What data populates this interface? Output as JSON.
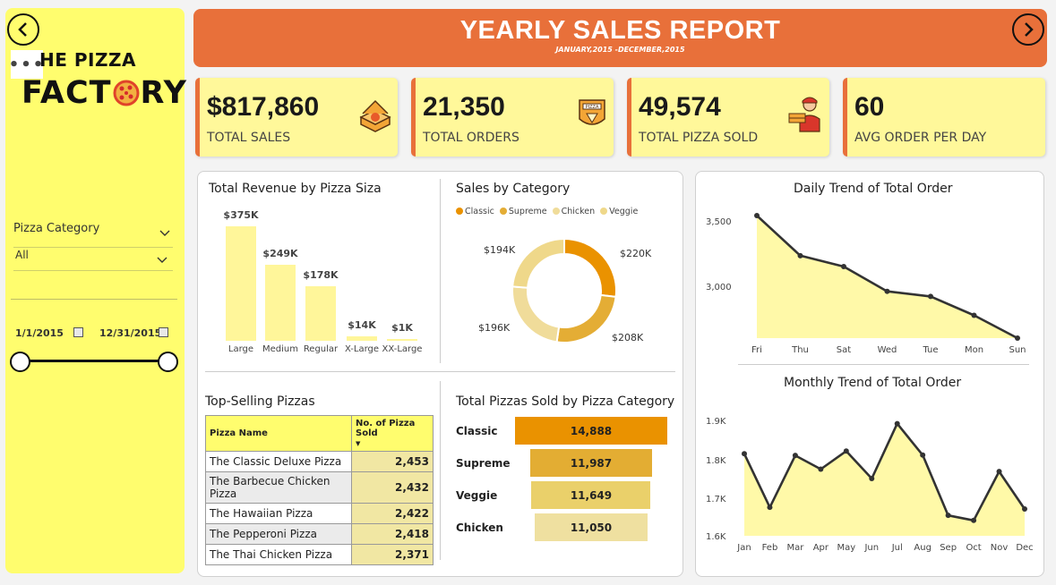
{
  "brand": {
    "line1": "HE PIZZA",
    "line2a": "FACT",
    "line2b": "RY",
    "more": "•••"
  },
  "filters": {
    "category_label": "Pizza Category",
    "category_value": "All",
    "date_start": "1/1/2015",
    "date_end": "12/31/2015"
  },
  "header": {
    "title": "YEARLY SALES REPORT",
    "subtitle": "JANUARY,2015 -DECEMBER,2015"
  },
  "kpis": [
    {
      "value": "$817,860",
      "label": "TOTAL SALES",
      "icon": "pizza-box-icon"
    },
    {
      "value": "21,350",
      "label": "TOTAL ORDERS",
      "icon": "pizza-bag-icon"
    },
    {
      "value": "49,574",
      "label": "TOTAL PIZZA SOLD",
      "icon": "delivery-man-icon"
    },
    {
      "value": "60",
      "label": "AVG ORDER PER DAY",
      "icon": ""
    }
  ],
  "colors": {
    "accent": "#e8703a",
    "sidebar": "#fffd6e",
    "kpi_bg": "#fff89a",
    "bar": "#fff69a",
    "line": "#333333",
    "area": "#fff9a8"
  },
  "chart_data": [
    {
      "type": "bar",
      "title": "Total Revenue by Pizza Siza",
      "categories": [
        "Large",
        "Medium",
        "Regular",
        "X-Large",
        "XX-Large"
      ],
      "values": [
        375,
        249,
        178,
        14,
        1
      ],
      "value_labels": [
        "$375K",
        "$249K",
        "$178K",
        "$14K",
        "$1K"
      ],
      "ylim": [
        0,
        375
      ]
    },
    {
      "type": "pie",
      "title": "Sales by Category",
      "legend_position": "top",
      "categories": [
        "Classic",
        "Supreme",
        "Chicken",
        "Veggie"
      ],
      "values": [
        220,
        208,
        196,
        194
      ],
      "value_labels": [
        "$220K",
        "$208K",
        "$196K",
        "$194K"
      ],
      "colors": [
        "#ea9200",
        "#e4ad35",
        "#f0dc9a",
        "#efd88a"
      ]
    },
    {
      "type": "table",
      "title": "Top-Selling Pizzas",
      "columns": [
        "Pizza Name",
        "No. of Pizza Sold"
      ],
      "rows": [
        [
          "The Classic Deluxe Pizza",
          "2,453"
        ],
        [
          "The Barbecue Chicken Pizza",
          "2,432"
        ],
        [
          "The Hawaiian Pizza",
          "2,422"
        ],
        [
          "The Pepperoni Pizza",
          "2,418"
        ],
        [
          "The Thai Chicken Pizza",
          "2,371"
        ]
      ]
    },
    {
      "type": "bar",
      "title": "Total Pizzas Sold by Pizza Category",
      "categories": [
        "Classic",
        "Supreme",
        "Veggie",
        "Chicken"
      ],
      "values": [
        14888,
        11987,
        11649,
        11050
      ],
      "value_labels": [
        "14,888",
        "11,987",
        "11,649",
        "11,050"
      ],
      "colors": [
        "#ea9200",
        "#e3ad33",
        "#ead06a",
        "#efe0a0"
      ]
    },
    {
      "type": "area",
      "title": "Daily Trend of Total Order",
      "x": [
        "Fri",
        "Thu",
        "Sat",
        "Wed",
        "Tue",
        "Mon",
        "Sun"
      ],
      "y": [
        3538,
        3239,
        3158,
        2973,
        2935,
        2794,
        2624
      ],
      "yticks": [
        "3,500",
        "3,000"
      ],
      "ylim": [
        2624,
        3538
      ]
    },
    {
      "type": "area",
      "title": "Monthly Trend of Total Order",
      "x": [
        "Jan",
        "Feb",
        "Mar",
        "Apr",
        "May",
        "Jun",
        "Jul",
        "Aug",
        "Sep",
        "Oct",
        "Nov",
        "Dec"
      ],
      "y": [
        1845,
        1685,
        1840,
        1799,
        1853,
        1771,
        1935,
        1841,
        1661,
        1646,
        1792,
        1680
      ],
      "yticks": [
        "1.9K",
        "1.8K",
        "1.7K",
        "1.6K"
      ],
      "ylim": [
        1600,
        1950
      ]
    }
  ]
}
